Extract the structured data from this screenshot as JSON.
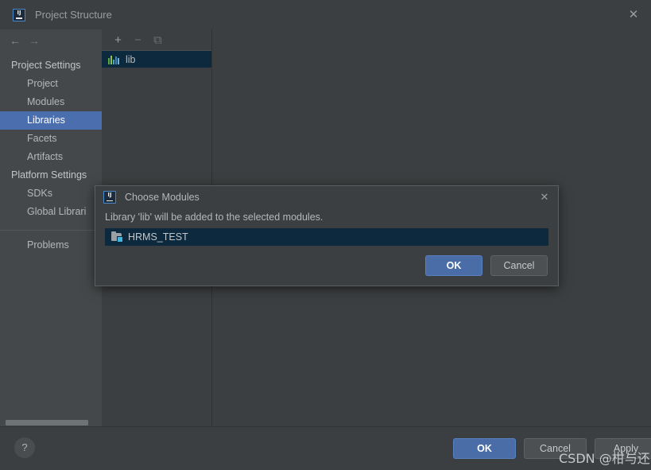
{
  "window": {
    "title": "Project Structure",
    "logo_text": "IJ",
    "close_icon": "✕"
  },
  "sidebar": {
    "back_icon": "←",
    "forward_icon": "→",
    "items": [
      {
        "label": "Project Settings",
        "type": "group",
        "selected": false
      },
      {
        "label": "Project",
        "type": "child",
        "selected": false
      },
      {
        "label": "Modules",
        "type": "child",
        "selected": false
      },
      {
        "label": "Libraries",
        "type": "child",
        "selected": true
      },
      {
        "label": "Facets",
        "type": "child",
        "selected": false
      },
      {
        "label": "Artifacts",
        "type": "child",
        "selected": false
      },
      {
        "label": "Platform Settings",
        "type": "group",
        "selected": false
      },
      {
        "label": "SDKs",
        "type": "child",
        "selected": false
      },
      {
        "label": "Global Librari",
        "type": "child",
        "selected": false
      }
    ],
    "after_separator": [
      {
        "label": "Problems",
        "type": "child",
        "selected": false
      }
    ]
  },
  "libraries_panel": {
    "toolbar": {
      "add_icon": "+",
      "remove_icon": "−",
      "copy_icon": "⧉"
    },
    "entries": [
      {
        "label": "lib",
        "icon": "library-icon",
        "selected": true
      }
    ],
    "library_icon_bar_colors": [
      "#5fa93a",
      "#8cc24a",
      "#4aa3c7",
      "#3c87b8",
      "#6fb4d8"
    ]
  },
  "bottom_bar": {
    "help_label": "?",
    "buttons": [
      {
        "label": "OK",
        "style": "primary"
      },
      {
        "label": "Cancel",
        "style": "default"
      },
      {
        "label": "Apply",
        "style": "default"
      }
    ]
  },
  "dialog": {
    "title": "Choose Modules",
    "logo_text": "IJ",
    "close_icon": "✕",
    "message": "Library 'lib' will be added to the selected modules.",
    "modules": [
      {
        "label": "HRMS_TEST",
        "icon": "module-folder-icon",
        "selected": true
      }
    ],
    "buttons": [
      {
        "label": "OK",
        "style": "primary"
      },
      {
        "label": "Cancel",
        "style": "default"
      }
    ]
  },
  "watermark": {
    "text": "CSDN @柑与还"
  },
  "colors": {
    "window_background": "#3c3f41",
    "sidebar_background": "#45484a",
    "selection_blue": "#4b6eaf",
    "list_selection_dark": "#0d293e",
    "primary_button": "#4a6da7",
    "text": "#b4b7b9"
  }
}
